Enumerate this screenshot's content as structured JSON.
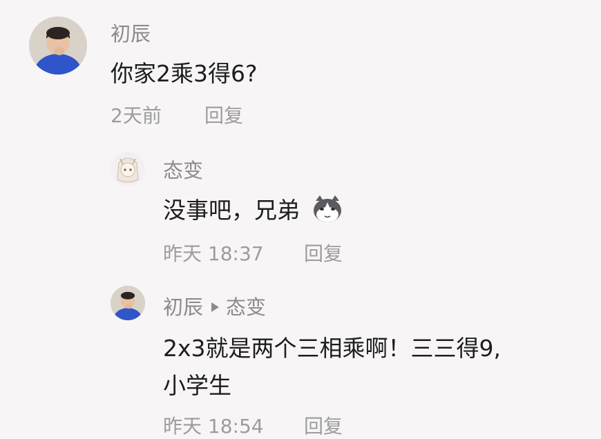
{
  "comments": [
    {
      "author": "初辰",
      "text": "你家2乘3得6?",
      "time": "2天前",
      "reply_label": "回复",
      "avatar_icon": "boy-avatar-icon"
    },
    {
      "author": "态变",
      "text": "没事吧，兄弟",
      "emoji_icon": "cat-face-emoji-icon",
      "time": "昨天 18:37",
      "reply_label": "回复",
      "avatar_icon": "anime-girl-avatar-icon"
    },
    {
      "author": "初辰",
      "reply_to": "态变",
      "text_line1": "2x3就是两个三相乘啊！三三得9,",
      "text_line2": "小学生",
      "time": "昨天 18:54",
      "reply_label": "回复",
      "avatar_icon": "boy-avatar-icon"
    }
  ]
}
